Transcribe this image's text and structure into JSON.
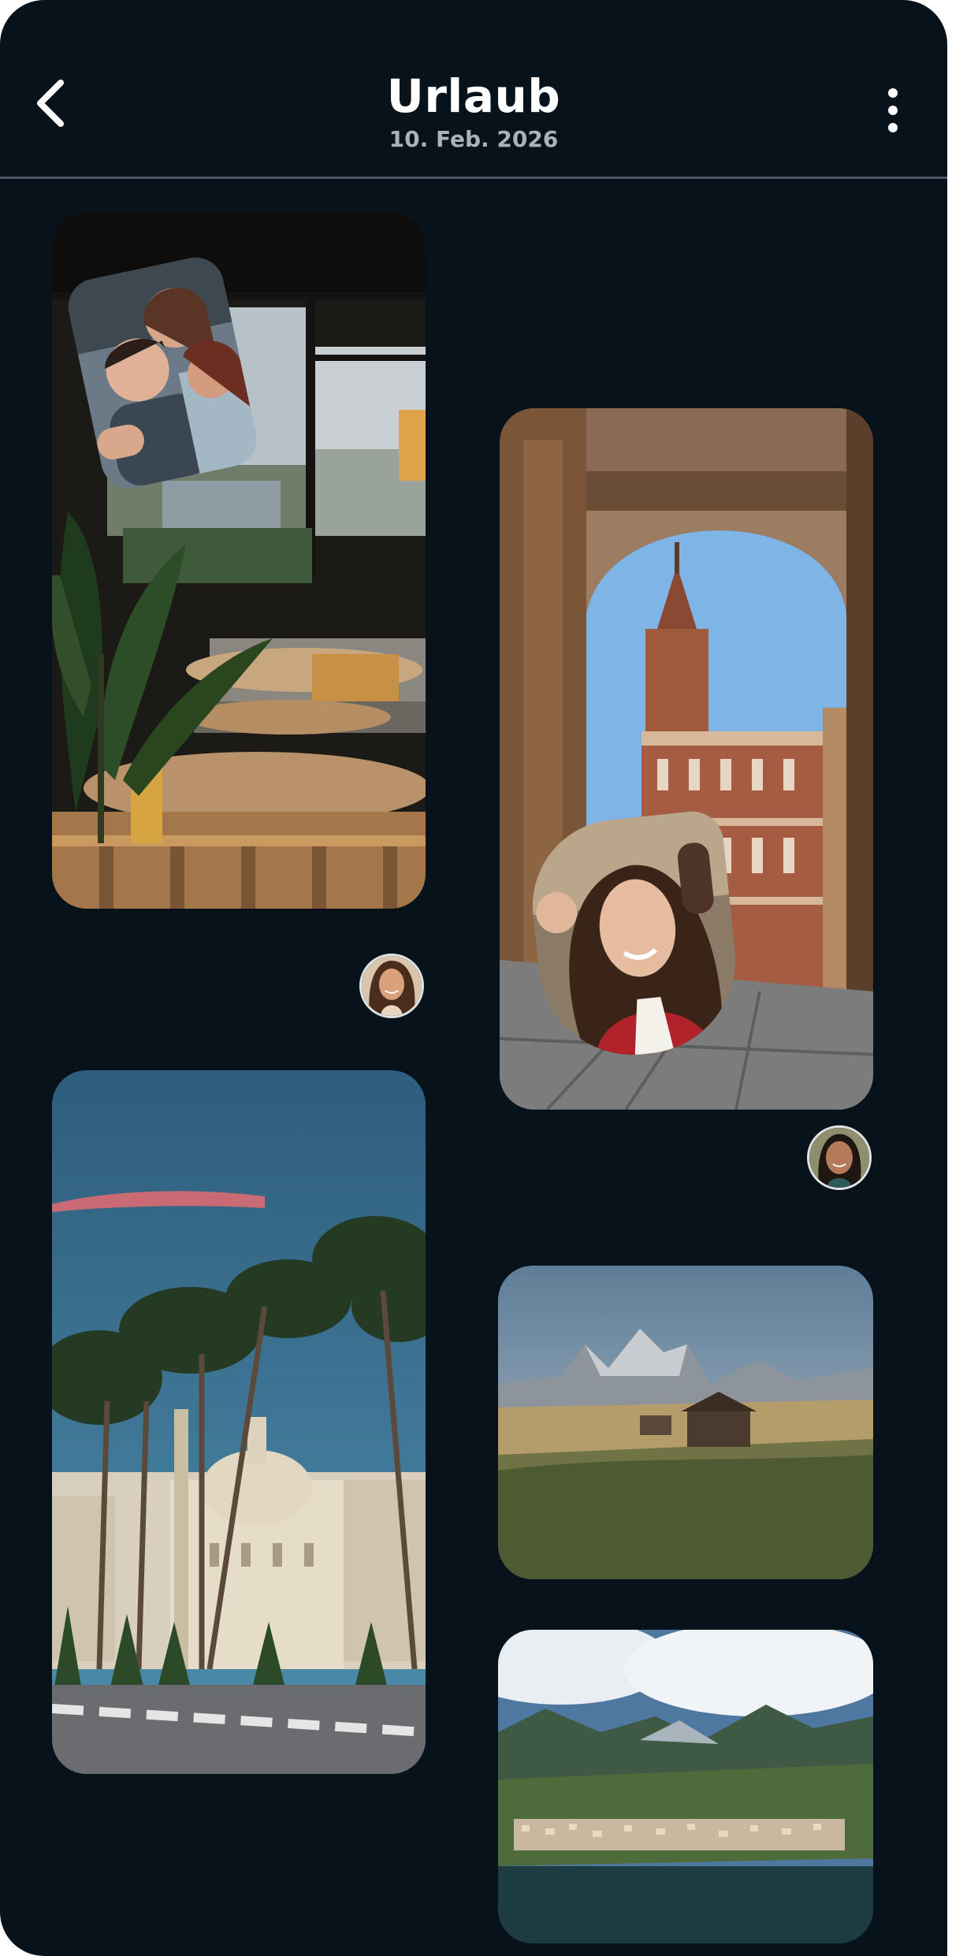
{
  "header": {
    "title": "Urlaub",
    "date": "10. Feb. 2026",
    "back_icon": "chevron-left-icon",
    "menu_icon": "more-vertical-icon"
  },
  "colors": {
    "background": "#07121b",
    "header_text": "#ffffff",
    "date_text": "#aab2ba",
    "divider": "#4b5660"
  },
  "photos": [
    {
      "id": "restaurant",
      "subject": "restaurant terrace interior with tables and plants",
      "selfie_overlay": true,
      "has_avatar": true
    },
    {
      "id": "archway",
      "subject": "stone archway with clock tower and red-brick palazzo",
      "selfie_overlay": true,
      "has_avatar": true
    },
    {
      "id": "rome",
      "subject": "domed church behind umbrella pine trees",
      "selfie_overlay": false,
      "has_avatar": false
    },
    {
      "id": "alpine",
      "subject": "alpine meadow with wooden hut and rocky peaks",
      "selfie_overlay": false,
      "has_avatar": false
    },
    {
      "id": "lake",
      "subject": "lakeside town beneath green mountains",
      "selfie_overlay": false,
      "has_avatar": false
    }
  ]
}
